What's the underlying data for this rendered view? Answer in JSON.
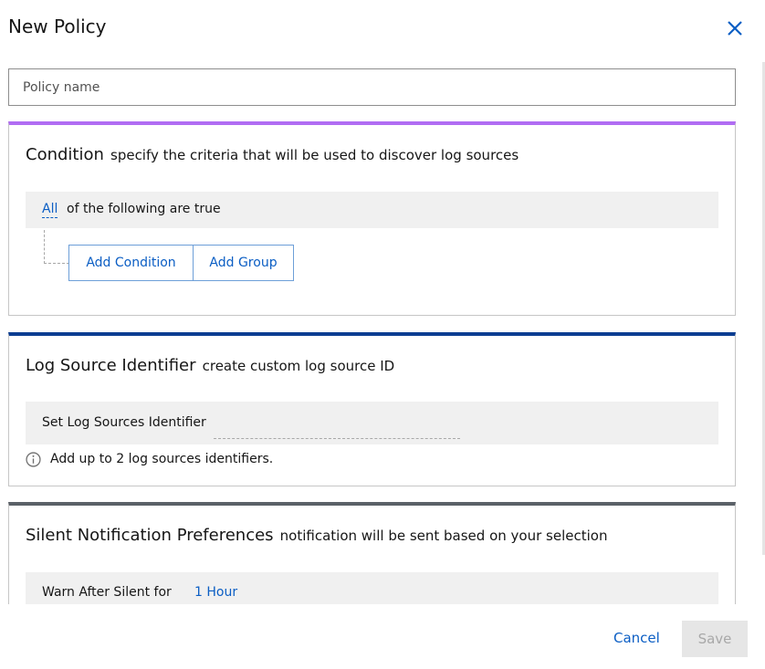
{
  "dialog": {
    "title": "New Policy",
    "close_icon": "close-icon",
    "policy_name_placeholder": "Policy name"
  },
  "condition": {
    "title": "Condition",
    "description": "specify the criteria that will be used to discover log sources",
    "match_value": "All",
    "match_text": "of the following are true",
    "add_condition_label": "Add Condition",
    "add_group_label": "Add Group",
    "accent_color": "#b16df3"
  },
  "log_source": {
    "title": "Log Source Identifier",
    "description": "create custom log source ID",
    "field_label": "Set Log Sources Identifier",
    "field_value": "",
    "info_text": "Add up to 2 log sources identifiers.",
    "info_icon": "info-icon",
    "accent_color": "#0b3d91"
  },
  "silent": {
    "title": "Silent Notification Preferences",
    "description": "notification will be sent based on your selection",
    "warn_label": "Warn After Silent for",
    "warn_value": "1 Hour",
    "accent_color": "#5b6168"
  },
  "footer": {
    "cancel_label": "Cancel",
    "save_label": "Save"
  }
}
